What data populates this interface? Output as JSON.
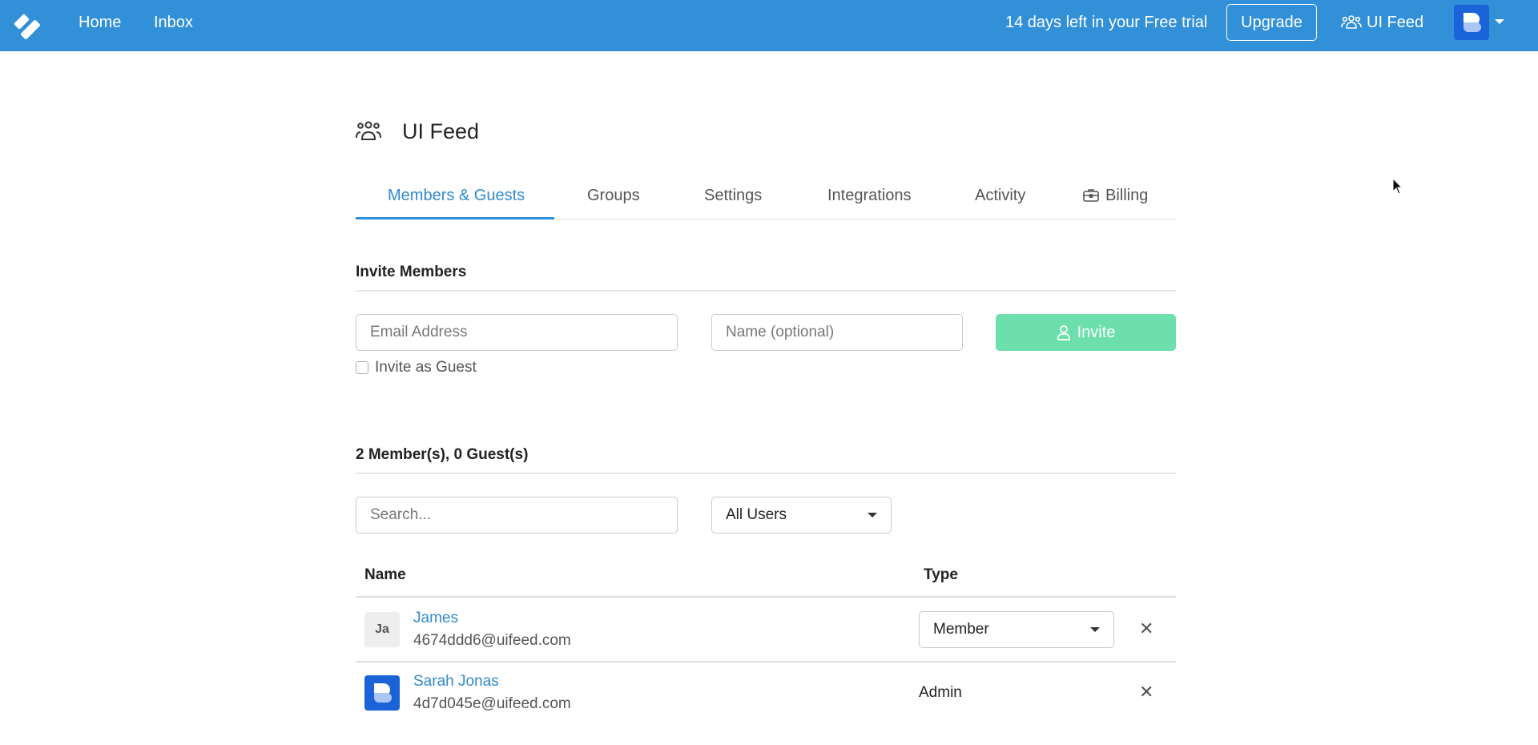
{
  "topbar": {
    "logo_icon": "app-logo-icon",
    "nav": [
      {
        "label": "Home"
      },
      {
        "label": "Inbox"
      }
    ],
    "trial_text": "14 days left in your Free trial",
    "upgrade_label": "Upgrade",
    "team_label": "UI Feed",
    "team_icon": "users-icon",
    "avatar_icon": "user-avatar",
    "colors": {
      "bar": "#3190d8"
    }
  },
  "page": {
    "title": "UI Feed",
    "title_icon": "users-icon"
  },
  "tabs": [
    {
      "label": "Members & Guests",
      "active": true
    },
    {
      "label": "Groups"
    },
    {
      "label": "Settings"
    },
    {
      "label": "Integrations"
    },
    {
      "label": "Activity"
    },
    {
      "label": "Billing",
      "icon": "briefcase-icon"
    }
  ],
  "invite": {
    "section_title": "Invite Members",
    "email_placeholder": "Email Address",
    "email_value": "",
    "name_placeholder": "Name (optional)",
    "name_value": "",
    "invite_label": "Invite",
    "invite_icon": "user-icon",
    "guest_checkbox_label": "Invite as Guest",
    "guest_checked": false,
    "colors": {
      "invite_button": "#6ddfac"
    }
  },
  "members": {
    "summary": "2 Member(s), 0 Guest(s)",
    "search_placeholder": "Search...",
    "search_value": "",
    "filter_selected": "All Users",
    "columns": [
      "Name",
      "Type"
    ],
    "rows": [
      {
        "initials": "Ja",
        "name": "James",
        "email": "4674ddd6@uifeed.com",
        "type": "Member",
        "type_editable": true
      },
      {
        "initials": "",
        "name": "Sarah Jonas",
        "email": "4d7d045e@uifeed.com",
        "type": "Admin",
        "type_editable": false
      }
    ],
    "remove_icon": "close-icon"
  },
  "colors": {
    "accent": "#2f8ad2"
  }
}
